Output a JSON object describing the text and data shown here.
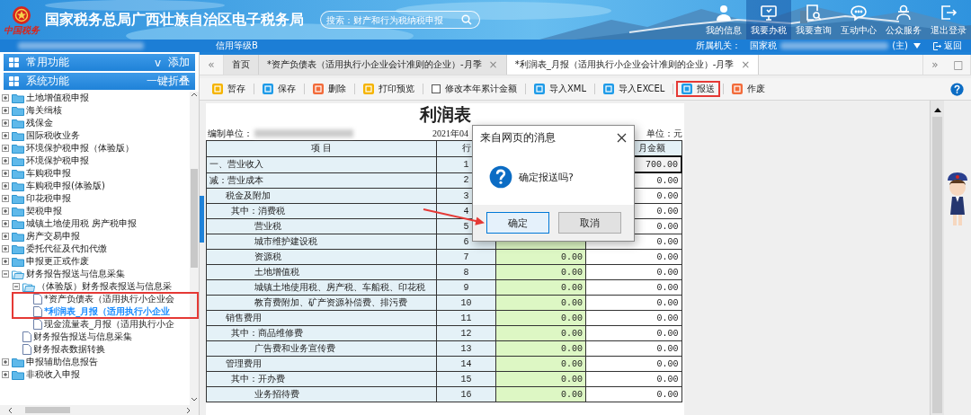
{
  "header": {
    "logo_text": "中国税务",
    "title": "国家税务总局广西壮族自治区电子税务局",
    "search": {
      "placeholder": "搜索：财产和行为税纳税申报"
    },
    "nav": [
      {
        "kind": "person",
        "label": "我的信息",
        "selected": false
      },
      {
        "kind": "monitor",
        "label": "我要办税",
        "selected": true
      },
      {
        "kind": "inspect",
        "label": "我要查询",
        "selected": false
      },
      {
        "kind": "chat",
        "label": "互动中心",
        "selected": false
      },
      {
        "kind": "people",
        "label": "公众服务",
        "selected": false
      },
      {
        "kind": "exit",
        "label": "退出登录",
        "selected": false
      }
    ]
  },
  "subbar": {
    "credit": "信用等级B",
    "authority_label": "所属机关：",
    "authority": "国家税",
    "authority_suffix": "(主)",
    "back": "返回"
  },
  "sidebar": {
    "sections": [
      {
        "label": "常用功能",
        "caret": "v",
        "action": "添加"
      },
      {
        "label": "系统功能",
        "action": "一键折叠"
      }
    ],
    "tree": [
      {
        "kind": "folder",
        "label": "土地增值税申报",
        "expanded": false,
        "selected": false
      },
      {
        "kind": "folder",
        "label": "海关缉核",
        "expanded": false,
        "selected": false
      },
      {
        "kind": "folder",
        "label": "残保金",
        "expanded": false,
        "selected": false
      },
      {
        "kind": "folder",
        "label": "国际税收业务",
        "expanded": false,
        "selected": false
      },
      {
        "kind": "folder",
        "label": "环境保护税申报（体验版）",
        "expanded": false,
        "selected": false
      },
      {
        "kind": "folder",
        "label": "环境保护税申报",
        "expanded": false,
        "selected": false
      },
      {
        "kind": "folder",
        "label": "车购税申报",
        "expanded": false,
        "selected": false
      },
      {
        "kind": "folder",
        "label": "车购税申报(体验版)",
        "expanded": false,
        "selected": false
      },
      {
        "kind": "folder",
        "label": "印花税申报",
        "expanded": false,
        "selected": false
      },
      {
        "kind": "folder",
        "label": "契税申报",
        "expanded": false,
        "selected": false
      },
      {
        "kind": "folder",
        "label": "城镇土地使用税 房产税申报",
        "expanded": false,
        "selected": false
      },
      {
        "kind": "folder",
        "label": "房产交易申报",
        "expanded": false,
        "selected": false
      },
      {
        "kind": "folder",
        "label": "委托代征及代扣代缴",
        "expanded": false,
        "selected": false
      },
      {
        "kind": "folder",
        "label": "申报更正或作废",
        "expanded": false,
        "selected": false
      },
      {
        "kind": "folder",
        "label": "财务报告报送与信息采集",
        "expanded": true,
        "selected": false,
        "children": [
          {
            "kind": "folder",
            "label": "（体验版）财务报表报送与信息采",
            "expanded": true,
            "selected": false,
            "children": [
              {
                "kind": "doc",
                "label": "*资产负债表（适用执行小企业会",
                "selected": false,
                "annotated": true
              },
              {
                "kind": "doc",
                "label": "*利润表_月报（适用执行小企业",
                "selected": true,
                "annotated": true
              },
              {
                "kind": "doc",
                "label": "现金流量表_月报（适用执行小企",
                "selected": false,
                "annotated": false
              }
            ]
          },
          {
            "kind": "doc",
            "label": "财务报告报送与信息采集",
            "selected": false
          },
          {
            "kind": "doc",
            "label": "财务报表数据转换",
            "selected": false
          }
        ]
      },
      {
        "kind": "folder",
        "label": "申报辅助信息报告",
        "expanded": false,
        "selected": false
      },
      {
        "kind": "folder",
        "label": "非税收入申报",
        "expanded": false,
        "selected": false
      }
    ]
  },
  "tabs": {
    "prev": "«",
    "next": "»",
    "restore": "□",
    "items": [
      {
        "label": "首页",
        "selected": false
      },
      {
        "label": "*资产负债表（适用执行小企业会计准则的企业）-月季",
        "close": "×",
        "selected": false
      },
      {
        "label": "*利润表_月报（适用执行小企业会计准则的企业）-月季",
        "close": "×",
        "selected": true
      }
    ]
  },
  "toolbar": {
    "items": [
      {
        "kind": "button",
        "label": "暂存",
        "color": "#f5b400",
        "annotated": false
      },
      {
        "kind": "button",
        "label": "保存",
        "color": "#1e9be8",
        "annotated": false
      },
      {
        "kind": "button",
        "label": "删除",
        "color": "#f26b3a",
        "annotated": false
      },
      {
        "kind": "button",
        "label": "打印预览",
        "color": "#f5b400",
        "annotated": false
      },
      {
        "kind": "checkbox",
        "label": "修改本年累计金额",
        "checked": false
      },
      {
        "kind": "button",
        "label": "导入XML",
        "color": "#1e9be8",
        "annotated": false
      },
      {
        "kind": "button",
        "label": "导入EXCEL",
        "color": "#1e9be8",
        "annotated": false
      },
      {
        "kind": "button",
        "label": "报送",
        "color": "#1e9be8",
        "annotated": true
      },
      {
        "kind": "button",
        "label": "作废",
        "color": "#f26b3a",
        "annotated": false
      }
    ]
  },
  "report": {
    "title": "利润表",
    "unit_label": "编制单位：",
    "date": "2021年04",
    "unit": "单位：元",
    "columns": [
      "项 目",
      "行",
      null,
      "月金额"
    ],
    "rows": [
      {
        "kind": "head",
        "item": "一、营业收入",
        "line": "1",
        "current": null,
        "year": "700.00",
        "focused": true
      },
      {
        "kind": "head",
        "item": "减：营业成本",
        "line": "2",
        "current": null,
        "year": "0.00",
        "focused": false
      },
      {
        "kind": "group",
        "item": "税金及附加",
        "line": "3",
        "current": null,
        "year": "0.00",
        "focused": false
      },
      {
        "kind": "note",
        "item": "其中：消费税",
        "line": "4",
        "current": null,
        "year": "0.00",
        "focused": false
      },
      {
        "kind": "detail",
        "item": "营业税",
        "line": "5",
        "current": null,
        "year": "0.00",
        "focused": false
      },
      {
        "kind": "detail",
        "item": "城市维护建设税",
        "line": "6",
        "current": null,
        "year": "0.00",
        "focused": false
      },
      {
        "kind": "detail",
        "item": "资源税",
        "line": "7",
        "current": "0.00",
        "year": "0.00",
        "focused": false
      },
      {
        "kind": "detail",
        "item": "土地增值税",
        "line": "8",
        "current": "0.00",
        "year": "0.00",
        "focused": false
      },
      {
        "kind": "detail",
        "item": "城镇土地使用税、房产税、车船税、印花税",
        "line": "9",
        "current": "0.00",
        "year": "0.00",
        "focused": false
      },
      {
        "kind": "detail",
        "item": "教育费附加、矿产资源补偿费、排污费",
        "line": "10",
        "current": "0.00",
        "year": "0.00",
        "focused": false
      },
      {
        "kind": "group",
        "item": "销售费用",
        "line": "11",
        "current": "0.00",
        "year": "0.00",
        "focused": false
      },
      {
        "kind": "note",
        "item": "其中：商品维修费",
        "line": "12",
        "current": "0.00",
        "year": "0.00",
        "focused": false
      },
      {
        "kind": "detail",
        "item": "广告费和业务宣传费",
        "line": "13",
        "current": "0.00",
        "year": "0.00",
        "focused": false
      },
      {
        "kind": "group",
        "item": "管理费用",
        "line": "14",
        "current": "0.00",
        "year": "0.00",
        "focused": false
      },
      {
        "kind": "note",
        "item": "其中：开办费",
        "line": "15",
        "current": "0.00",
        "year": "0.00",
        "focused": false
      },
      {
        "kind": "detail",
        "item": "业务招待费",
        "line": "16",
        "current": "0.00",
        "year": "0.00",
        "focused": false
      }
    ]
  },
  "dialog": {
    "title": "来自网页的消息",
    "message": "确定报送吗?",
    "buttons": [
      {
        "label": "确定",
        "focused": true,
        "annotated": true
      },
      {
        "label": "取消",
        "focused": false,
        "annotated": false
      }
    ]
  }
}
